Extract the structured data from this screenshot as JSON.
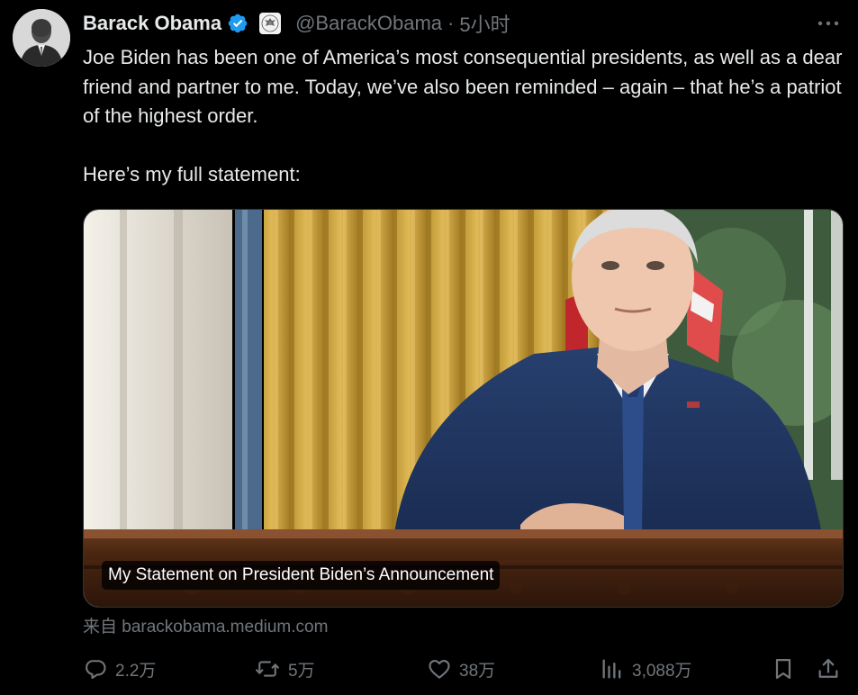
{
  "author": {
    "name": "Barack Obama",
    "handle": "@BarackObama",
    "separator": "·",
    "time": "5小时"
  },
  "tweet": {
    "text": "Joe Biden has been one of America’s most consequential presidents, as well as a dear friend and partner to me. Today, we’ve also been reminded – again – that he’s a patriot of the highest order.\n\nHere’s my full statement:"
  },
  "card": {
    "caption": "My Statement on President Biden’s Announcement",
    "source": "来自 barackobama.medium.com"
  },
  "actions": {
    "replies": "2.2万",
    "reposts": "5万",
    "likes": "38万",
    "views": "3,088万"
  },
  "icons": {
    "verified": "verified-badge-icon",
    "government": "us-seal-icon",
    "more": "more-icon",
    "reply": "reply-icon",
    "repost": "repost-icon",
    "like": "like-icon",
    "views": "views-icon",
    "bookmark": "bookmark-icon",
    "share": "share-icon"
  },
  "colors": {
    "background": "#000000",
    "text": "#e7e9ea",
    "muted": "#71767b",
    "verified": "#1d9bf0"
  }
}
